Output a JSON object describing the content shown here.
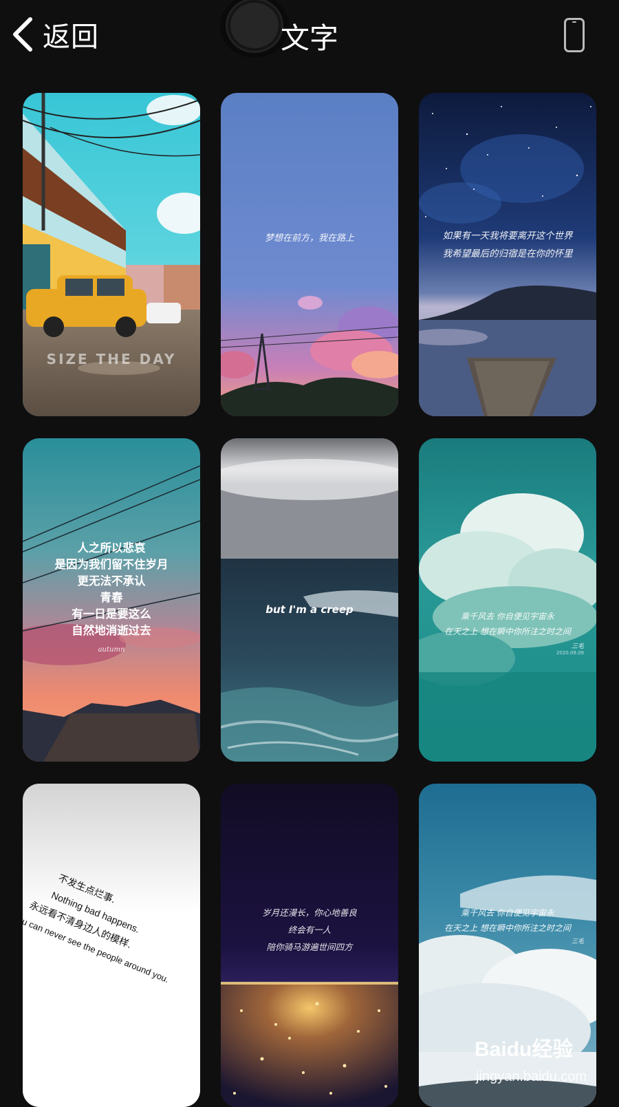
{
  "header": {
    "back_label": "返回",
    "title": "文字",
    "icons": {
      "back": "chevron-left-icon",
      "device": "phone-icon",
      "camera": "front-camera"
    }
  },
  "wallpapers": [
    {
      "id": "street-taxi",
      "text": "SIZE THE DAY"
    },
    {
      "id": "pink-sunset-tower",
      "text": "梦想在前方，我在路上"
    },
    {
      "id": "starry-lake",
      "lines": [
        "如果有一天我将要离开这个世界",
        "我希望最后的归宿是在你的怀里"
      ]
    },
    {
      "id": "power-lines-sunset",
      "lines": [
        "人之所以悲哀",
        "是因为我们留不住岁月",
        "更无法不承认",
        "青春",
        "有一日是要这么",
        "自然地消逝过去"
      ],
      "signature": "autumn"
    },
    {
      "id": "stormy-sea",
      "text": "but I'm a creep"
    },
    {
      "id": "teal-cloud",
      "lines": [
        "乘千风去 你自便见宇宙永",
        "在天之上 想在瞬中你所注之时之间"
      ],
      "signature": "三毛",
      "date": "2020.09.09"
    },
    {
      "id": "white-gradient",
      "lines": [
        "不发生点烂事.",
        "Nothing bad happens.",
        "永远看不清身边人的模样.",
        "You can never see the people around you."
      ]
    },
    {
      "id": "city-night",
      "lines": [
        "岁月还漫长，你心地善良",
        "终会有一人",
        "陪你骑马游遍世间四方"
      ]
    },
    {
      "id": "blue-sky-clouds",
      "lines": [
        "乘千风去 你自便见宇宙永",
        "在天之上 想在瞬中你所注之时之间"
      ],
      "signature": "三毛"
    }
  ],
  "watermark": {
    "logo": "Baidu经验",
    "url": "jingyan.baidu.com"
  }
}
